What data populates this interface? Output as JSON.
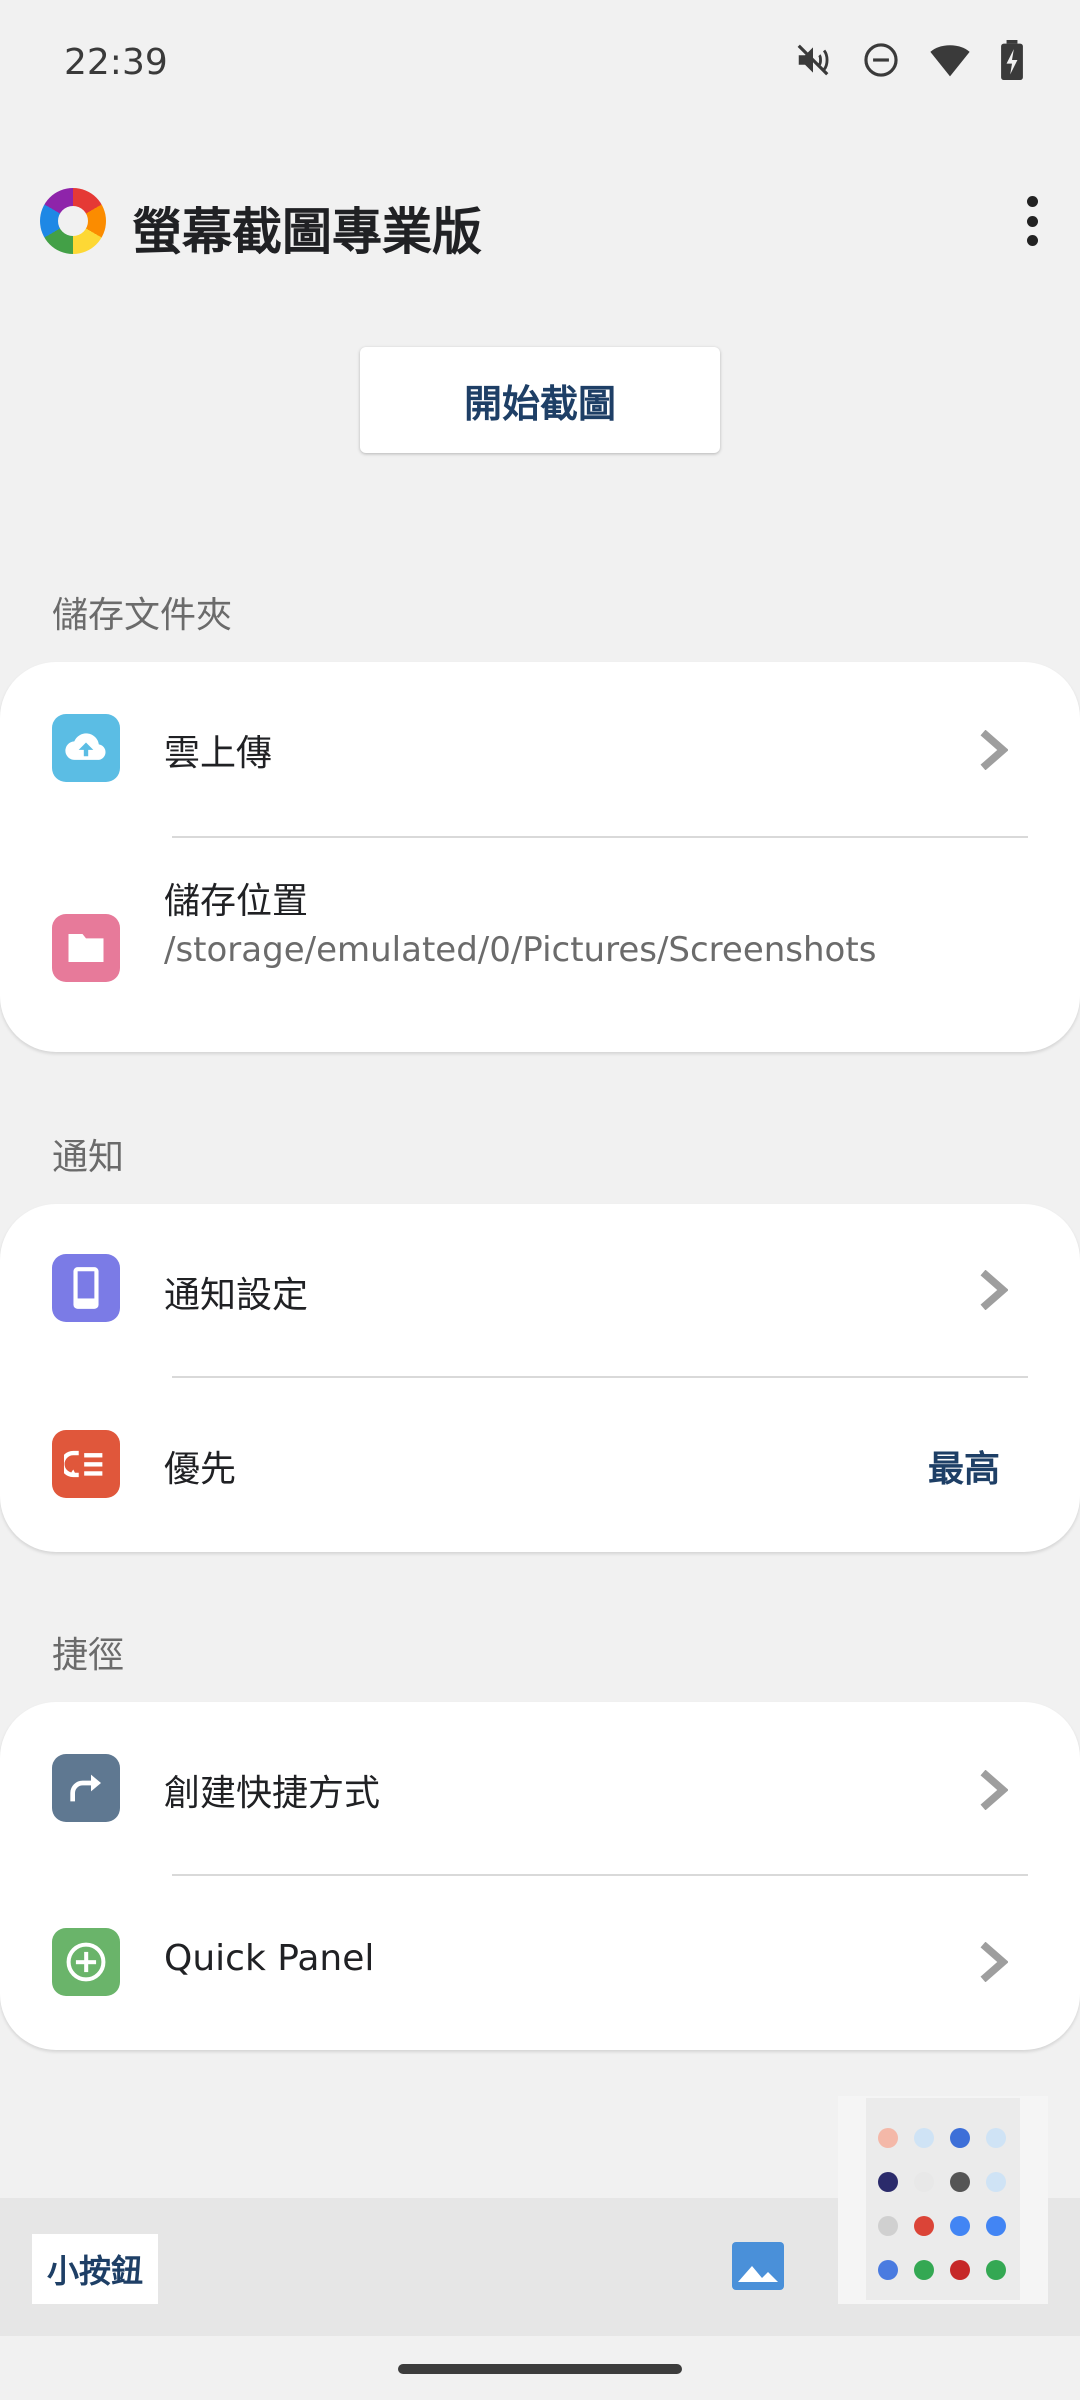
{
  "status_bar": {
    "time": "22:39",
    "icons": [
      "mute-icon",
      "do-not-disturb-icon",
      "wifi-icon",
      "battery-charging-icon"
    ]
  },
  "app_bar": {
    "title": "螢幕截圖專業版",
    "menu_icon": "more-vert-icon"
  },
  "start_button": {
    "label": "開始截圖"
  },
  "sections": {
    "storage": {
      "label": "儲存文件夾",
      "cloud_upload": {
        "label": "雲上傳",
        "icon": "cloud-upload-icon",
        "color": "#5bbde4"
      },
      "save_location": {
        "label": "儲存位置",
        "path": "/storage/emulated/0/Pictures/Screenshots",
        "icon": "folder-icon",
        "color": "#e77a9a"
      }
    },
    "notifications": {
      "label": "通知",
      "settings": {
        "label": "通知設定",
        "icon": "phone-icon",
        "color": "#7b7be6"
      },
      "priority": {
        "label": "優先",
        "value": "最高",
        "icon": "priority-icon",
        "color": "#e0573b"
      }
    },
    "shortcuts": {
      "label": "捷徑",
      "create_shortcut": {
        "label": "創建快捷方式",
        "icon": "share-arrow-icon",
        "color": "#5f7891"
      },
      "quick_panel": {
        "label": "Quick Panel",
        "icon": "add-circle-icon",
        "color": "#6ab46a"
      }
    }
  },
  "bottom_panel": {
    "small_button": "小按鈕",
    "gallery_icon": "image-icon"
  }
}
